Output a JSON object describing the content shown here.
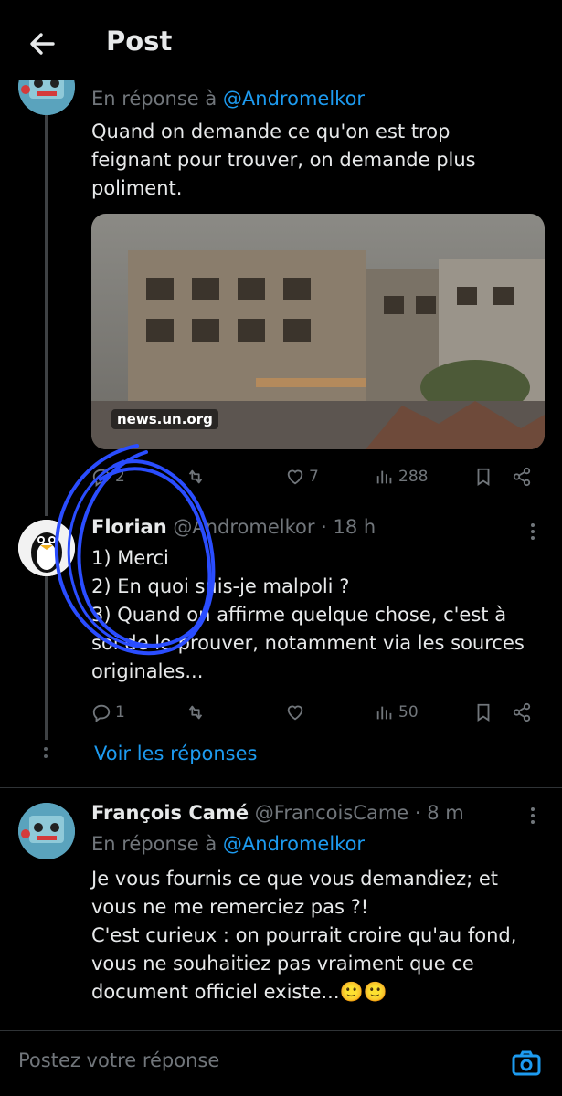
{
  "header": {
    "title": "Post"
  },
  "tweet1": {
    "reply_prefix": "En réponse à ",
    "reply_handle": "@Andromelkor",
    "lines": [
      "Quand on demande ce qu'on est trop",
      "feignant pour trouver, on demande plus",
      "poliment."
    ],
    "card_domain": "news.un.org",
    "replies": "2",
    "retweets": "",
    "likes": "7",
    "views": "288"
  },
  "tweet2": {
    "name": "Florian",
    "handle": "@Andromelkor",
    "time": " · 18 h",
    "lines": [
      "1) Merci",
      "2) En quoi suis-je malpoli ?",
      "3) Quand on affirme quelque chose, c'est à",
      "soi de le prouver, notamment via les sources",
      "originales..."
    ],
    "replies": "1",
    "retweets": "",
    "likes": "",
    "views": "50",
    "show_replies": "Voir les réponses"
  },
  "tweet3": {
    "name": "François Camé",
    "handle": "@FrancoisCame",
    "time": " · 8 m",
    "reply_prefix": "En réponse à ",
    "reply_handle": "@Andromelkor",
    "lines": [
      "Je vous fournis ce que vous demandiez; et",
      "vous ne me remerciez pas ?!",
      "C'est curieux : on pourrait croire qu'au fond,",
      "vous ne souhaitiez pas vraiment que ce",
      "document officiel existe...🙂🙂"
    ]
  },
  "compose": {
    "placeholder": "Postez votre réponse"
  },
  "colors": {
    "accent": "#1d9bf0",
    "muted": "#71767b",
    "background": "#000000",
    "annotation": "#2a4dff"
  }
}
